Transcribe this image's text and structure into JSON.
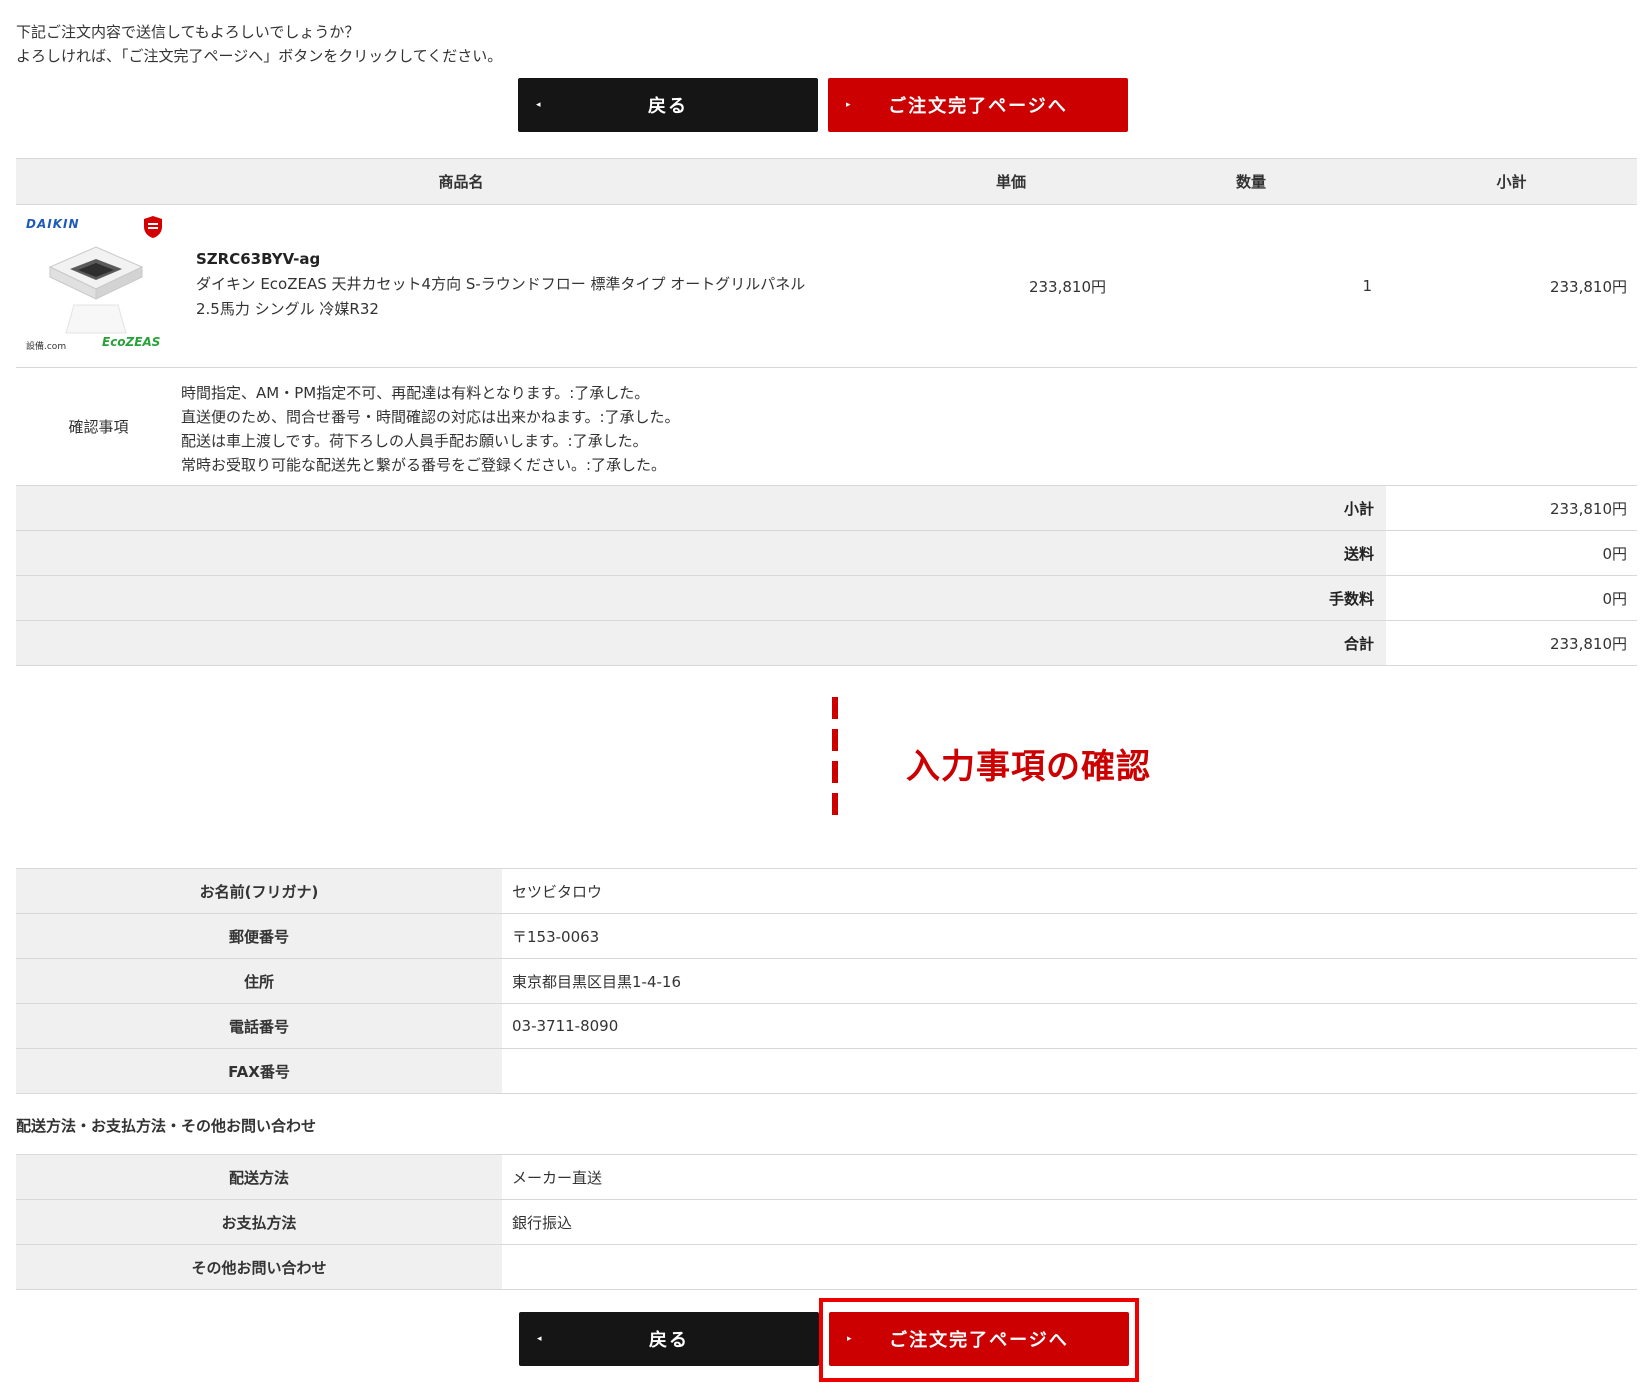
{
  "intro": {
    "line1": "下記ご注文内容で送信してもよろしいでしょうか？",
    "line2": "よろしければ、「ご注文完了ページへ」ボタンをクリックしてください。"
  },
  "buttons": {
    "back_label": "戻る",
    "next_label": "ご注文完了ページへ",
    "arrow": "◂",
    "arrow_next": "▸"
  },
  "cart": {
    "headers": {
      "product": "商品名",
      "unit_price": "単価",
      "quantity": "数量",
      "subtotal": "小計"
    },
    "item": {
      "brand": "DAIKIN",
      "badge": "1年保証",
      "shop_logo": "設備.com",
      "series_logo": "EcoZEAS",
      "code": "SZRC63BYV-ag",
      "description": "ダイキン EcoZEAS 天井カセット4方向 S-ラウンドフロー 標準タイプ オートグリルパネル 2.5馬力 シングル 冷媒R32",
      "unit_price": "233,810円",
      "quantity": "1",
      "subtotal": "233,810円"
    },
    "confirm": {
      "label": "確認事項",
      "lines": [
        "時間指定、AM・PM指定不可、再配達は有料となります。:了承した。",
        "直送便のため、問合せ番号・時間確認の対応は出来かねます。:了承した。",
        "配送は車上渡しです。荷下ろしの人員手配お願いします。:了承した。",
        "常時お受取り可能な配送先と繋がる番号をご登録ください。:了承した。"
      ]
    },
    "summary": [
      {
        "label": "小計",
        "value": "233,810円"
      },
      {
        "label": "送料",
        "value": "0円"
      },
      {
        "label": "手数料",
        "value": "0円"
      },
      {
        "label": "合計",
        "value": "233,810円"
      }
    ]
  },
  "section": {
    "title": "入力事項の確認"
  },
  "customer": [
    {
      "label": "お名前(フリガナ)",
      "value": "セツビタロウ"
    },
    {
      "label": "郵便番号",
      "value": "〒153-0063"
    },
    {
      "label": "住所",
      "value": "東京都目黒区目黒1-4-16"
    },
    {
      "label": "電話番号",
      "value": "03-3711-8090"
    },
    {
      "label": "FAX番号",
      "value": ""
    }
  ],
  "delivery": {
    "heading": "配送方法・お支払方法・その他お問い合わせ",
    "rows": [
      {
        "label": "配送方法",
        "value": "メーカー直送"
      },
      {
        "label": "お支払方法",
        "value": "銀行振込"
      },
      {
        "label": "その他お問い合わせ",
        "value": ""
      }
    ]
  },
  "colors": {
    "accent": "#cc0000",
    "dark_button": "#151515",
    "header_bg": "#f0f0f0",
    "highlight": "#ee0000"
  }
}
